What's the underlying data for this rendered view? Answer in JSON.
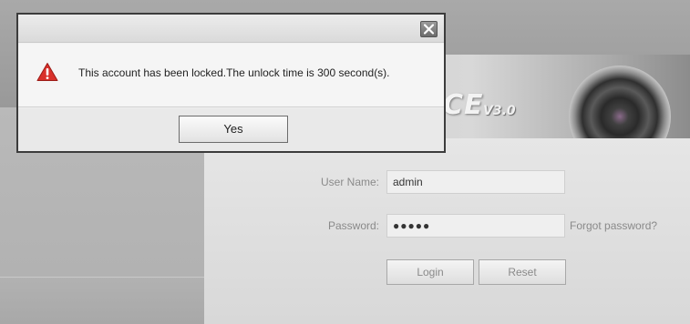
{
  "dialog": {
    "message": "This account has been locked.The unlock time is 300 second(s).",
    "confirm_label": "Yes",
    "icons": {
      "close": "close-x-icon",
      "warning": "warning-triangle-icon"
    }
  },
  "banner": {
    "logo_text": "CE",
    "logo_version": "V3.0"
  },
  "login": {
    "username_label": "User Name:",
    "username_value": "admin",
    "password_label": "Password:",
    "password_value": "●●●●●",
    "forgot_link": "Forgot password?",
    "login_label": "Login",
    "reset_label": "Reset"
  },
  "colors": {
    "warning_red": "#d9312b",
    "dialog_border": "#3c3c3c",
    "muted_text": "#8a8a8a"
  }
}
